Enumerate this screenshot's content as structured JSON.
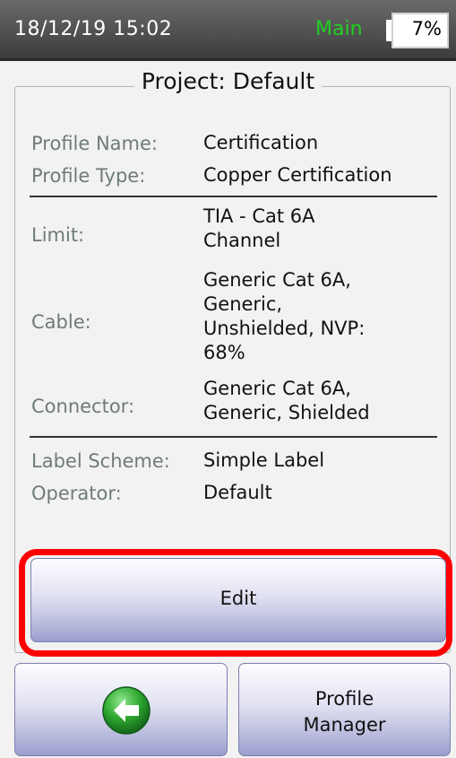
{
  "status_bar": {
    "datetime": "18/12/19 15:02",
    "mode": "Main",
    "battery_level": "7%",
    "battery_fraction": 0.07,
    "mode_color": "#22d022"
  },
  "project": {
    "title": "Project: Default",
    "fields": {
      "profile_name_label": "Profile Name:",
      "profile_name_value": "Certification",
      "profile_type_label": "Profile Type:",
      "profile_type_value": "Copper Certification",
      "limit_label": "Limit:",
      "limit_value_1": "TIA - Cat 6A",
      "limit_value_2": "Channel",
      "cable_label": "Cable:",
      "cable_value_1": "Generic Cat 6A,",
      "cable_value_2": "Generic,",
      "cable_value_3": "Unshielded, NVP:",
      "cable_value_4": "68%",
      "connector_label": "Connector:",
      "connector_value_1": "Generic Cat 6A,",
      "connector_value_2": "Generic, Shielded",
      "label_scheme_label": "Label Scheme:",
      "label_scheme_value": "Simple Label",
      "operator_label": "Operator:",
      "operator_value": "Default"
    }
  },
  "buttons": {
    "edit_label": "Edit",
    "back_icon": "back-arrow-icon",
    "profile_manager_line1": "Profile",
    "profile_manager_line2": "Manager"
  },
  "colors": {
    "highlight": "#ff0000",
    "back_icon_green": "#2fa82f"
  }
}
